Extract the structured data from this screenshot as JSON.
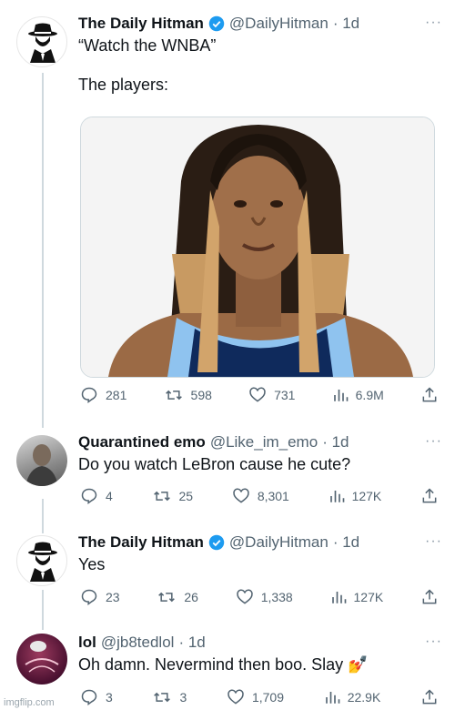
{
  "tweets": [
    {
      "name": "The Daily Hitman",
      "handle": "@DailyHitman",
      "time": "· 1d",
      "text": "“Watch the WNBA”",
      "text2": "The players:",
      "stats": {
        "replies": "281",
        "retweets": "598",
        "likes": "731",
        "views": "6.9M"
      }
    },
    {
      "name": "Quarantined emo",
      "handle": "@Like_im_emo",
      "time": "· 1d",
      "text": "Do you watch LeBron cause he cute?",
      "stats": {
        "replies": "4",
        "retweets": "25",
        "likes": "8,301",
        "views": "127K"
      }
    },
    {
      "name": "The Daily Hitman",
      "handle": "@DailyHitman",
      "time": "· 1d",
      "text": "Yes",
      "stats": {
        "replies": "23",
        "retweets": "26",
        "likes": "1,338",
        "views": "127K"
      }
    },
    {
      "name": "lol",
      "handle": "@jb8tedlol",
      "time": "· 1d",
      "text": "Oh damn. Nevermind then boo. Slay",
      "emoji": "💅",
      "stats": {
        "replies": "3",
        "retweets": "3",
        "likes": "1,709",
        "views": "22.9K"
      }
    }
  ],
  "more_label": "···",
  "watermark": "imgflip.com",
  "colors": {
    "verified": "#1d9bf0",
    "secondary": "#536471",
    "thread_line": "#cfd9de"
  },
  "icons": [
    "reply-icon",
    "retweet-icon",
    "like-icon",
    "views-icon",
    "share-icon",
    "verified-badge-icon",
    "more-icon"
  ]
}
